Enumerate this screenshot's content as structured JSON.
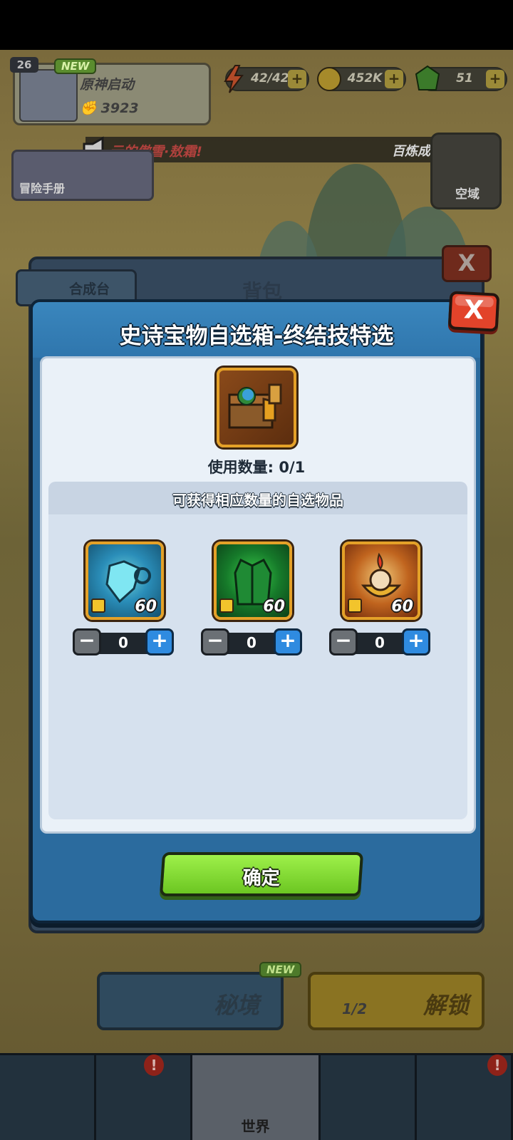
{
  "hud": {
    "level": "26",
    "new_tag": "NEW",
    "player_name": "原神启动",
    "power": "3923",
    "energy": "42/42",
    "coins": "452K",
    "gems": "51",
    "plus": "+"
  },
  "announcement": {
    "text": "云的傲雪·敖霜!",
    "right_text": "百炼成"
  },
  "side": {
    "adventure_book": "冒险手册",
    "sky_domain": "空域"
  },
  "background_panel": {
    "title": "背包",
    "craft_tab": "合成台",
    "close": "X"
  },
  "dialog": {
    "title": "史诗宝物自选箱-终结技特选",
    "close": "X",
    "use_count": "使用数量: 0/1",
    "subheader": "可获得相应数量的自选物品",
    "items": [
      {
        "name": "ice-heart-charm",
        "qty": "60",
        "count": "0"
      },
      {
        "name": "jade-vest",
        "qty": "60",
        "count": "0"
      },
      {
        "name": "fire-bowl",
        "qty": "60",
        "count": "0"
      }
    ],
    "minus": "−",
    "plus": "+",
    "confirm": "确定"
  },
  "lower": {
    "secret_realm": "秘境",
    "secret_new": "NEW",
    "unlock": "解锁",
    "unlock_count": "1/2"
  },
  "bottom_nav": {
    "world": "世界",
    "badge": "!"
  }
}
